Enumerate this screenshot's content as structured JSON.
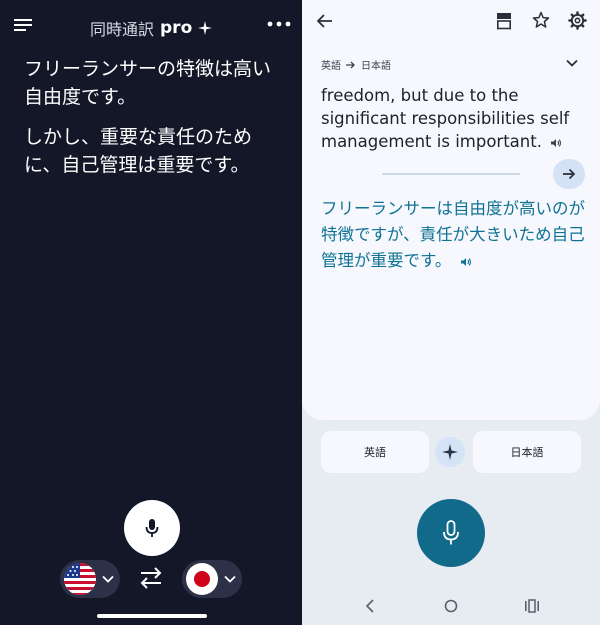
{
  "left_panel": {
    "app_title": "同時通訳",
    "app_badge": "pro",
    "transcript": [
      "フリーランサーの特徴は高い自由度です。",
      "しかし、重要な責任のために、自己管理は重要です。"
    ],
    "source_flag": "us-flag-icon",
    "target_flag": "jp-flag-icon"
  },
  "right_panel": {
    "lang_route_source": "英語",
    "lang_route_target": "日本語",
    "source_text": "freedom, but due to the significant responsibilities self management is important.",
    "translated_text": "フリーランサーは自由度が高いのが特徴ですが、責任が大きいため自己管理が重要です。",
    "source_lang_button": "英語",
    "target_lang_button": "日本語"
  },
  "colors": {
    "left_bg": "#131728",
    "right_bg": "#e7ebf2",
    "card_bg": "#f6f8fd",
    "accent_teal": "#126a8b",
    "translation_text": "#0f7295"
  }
}
